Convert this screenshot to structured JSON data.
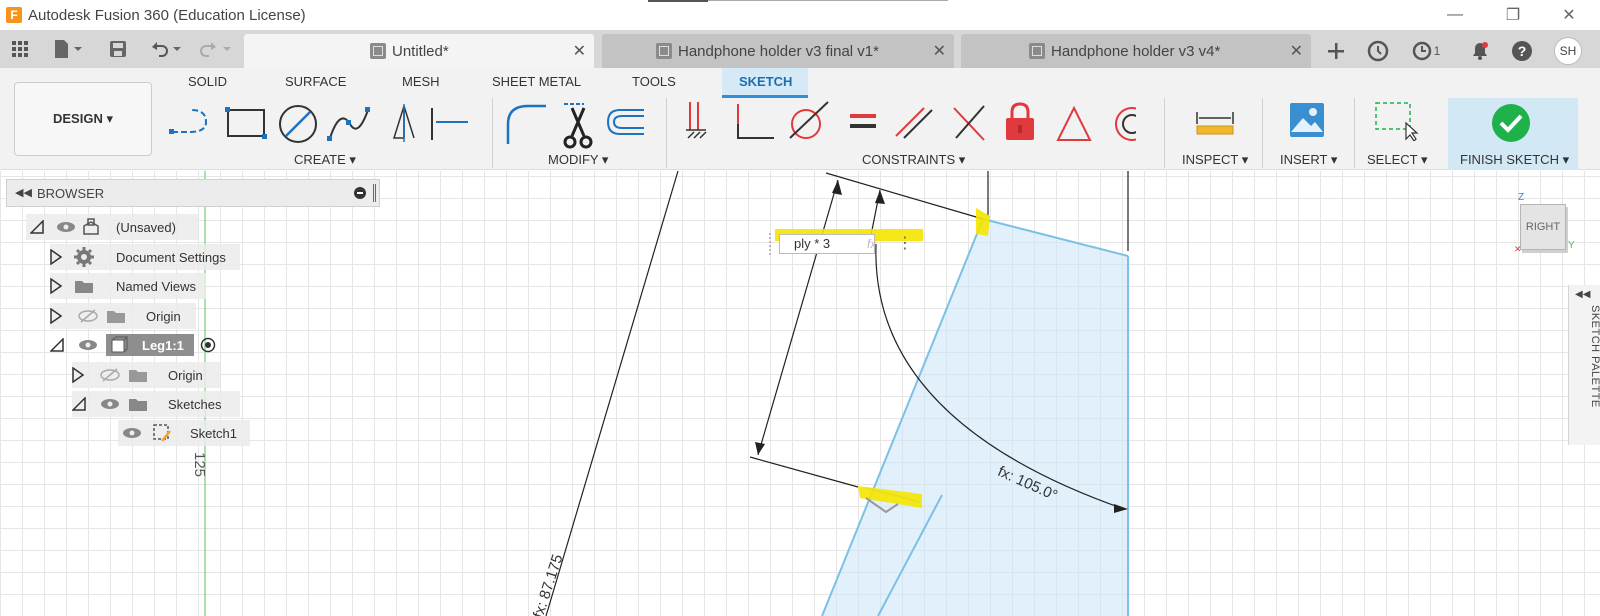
{
  "window": {
    "title": "Autodesk Fusion 360 (Education License)",
    "logo_letter": "F",
    "controls": {
      "minimize": "—",
      "restore": "❐",
      "close": "✕"
    }
  },
  "quick_access": {
    "icons": [
      "grid-icon",
      "file-icon",
      "save-icon",
      "undo-icon",
      "redo-icon"
    ]
  },
  "tabs": [
    {
      "label": "Untitled*",
      "active": true,
      "close": "✕"
    },
    {
      "label": "Handphone holder v3 final v1*",
      "active": false,
      "close": "✕"
    },
    {
      "label": "Handphone holder v3 v4*",
      "active": false,
      "close": "✕"
    }
  ],
  "header_right": {
    "job_count": "1",
    "user_initials": "SH"
  },
  "workspace": {
    "design_label": "DESIGN ▾",
    "tabs": [
      "SOLID",
      "SURFACE",
      "MESH",
      "SHEET METAL",
      "TOOLS",
      "SKETCH"
    ],
    "active_tab": "SKETCH"
  },
  "tool_groups": {
    "create": "CREATE ▾",
    "modify": "MODIFY ▾",
    "constraints": "CONSTRAINTS ▾",
    "inspect": "INSPECT ▾",
    "insert": "INSERT ▾",
    "select": "SELECT ▾",
    "finish": "FINISH SKETCH ▾"
  },
  "browser": {
    "title": "BROWSER",
    "items": [
      {
        "label": "(Unsaved)"
      },
      {
        "label": "Document Settings"
      },
      {
        "label": "Named Views"
      },
      {
        "label": "Origin"
      },
      {
        "label": "Leg1:1"
      },
      {
        "label": "Origin"
      },
      {
        "label": "Sketches"
      },
      {
        "label": "Sketch1"
      }
    ]
  },
  "canvas": {
    "axis_label": "125",
    "dimension_input": "ply * 3",
    "dimension_fx": "fx",
    "angle_dim": "fx: 105.0°",
    "length_dim": "fx: 87.175"
  },
  "viewcube": {
    "face": "RIGHT",
    "axis_z": "Z",
    "axis_y": "Y"
  },
  "sketch_palette": {
    "label": "SKETCH PALETTE"
  },
  "colors": {
    "accent": "#2f8fd8",
    "sketch_blue": "#7cc0e6",
    "highlight": "#f5e400",
    "finish_green": "#1fb24a",
    "lock_red": "#e0393e"
  }
}
